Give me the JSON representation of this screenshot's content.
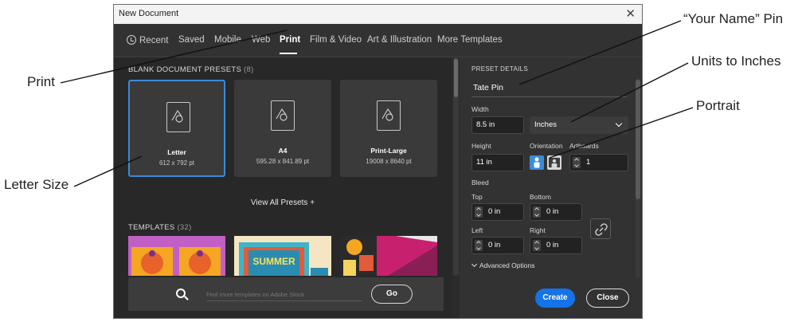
{
  "annotations": {
    "your_name_pin": "“Your Name” Pin",
    "units_to_inches": "Units to Inches",
    "portrait": "Portrait",
    "print": "Print",
    "letter_size": "Letter Size"
  },
  "window": {
    "title": "New Document",
    "close_glyph": "✕"
  },
  "tabs": [
    {
      "label": "Recent",
      "icon": "clock-icon"
    },
    {
      "label": "Saved"
    },
    {
      "label": "Mobile"
    },
    {
      "label": "Web"
    },
    {
      "label": "Print",
      "active": true
    },
    {
      "label": "Film & Video"
    },
    {
      "label": "Art & Illustration"
    },
    {
      "label": "More Templates"
    }
  ],
  "blank_presets": {
    "title": "BLANK DOCUMENT PRESETS",
    "count": "(8)",
    "items": [
      {
        "name": "Letter",
        "size": "612 x 792 pt",
        "selected": true
      },
      {
        "name": "A4",
        "size": "595.28 x 841.89 pt"
      },
      {
        "name": "Print-Large",
        "size": "19008 x 8640 pt"
      }
    ],
    "view_all": "View All Presets +"
  },
  "templates": {
    "title": "TEMPLATES",
    "count": "(32)",
    "thumb2_text": "SUMMER"
  },
  "search": {
    "placeholder": "Find more templates on Adobe Stock",
    "go_label": "Go"
  },
  "preset_details": {
    "title": "PRESET DETAILS",
    "name": "Tate Pin",
    "width_label": "Width",
    "width_value": "8.5 in",
    "units": "Inches",
    "height_label": "Height",
    "height_value": "11 in",
    "orientation_label": "Orientation",
    "artboards_label": "Artboards",
    "artboards_value": "1",
    "bleed_label": "Bleed",
    "top_label": "Top",
    "top_value": "0 in",
    "bottom_label": "Bottom",
    "bottom_value": "0 in",
    "left_label": "Left",
    "left_value": "0 in",
    "right_label": "Right",
    "right_value": "0 in",
    "advanced_label": "Advanced Options"
  },
  "buttons": {
    "create": "Create",
    "close": "Close"
  },
  "colors": {
    "accent": "#1473e6",
    "selection": "#3a8bd8",
    "panel": "#323232",
    "background": "#282828"
  }
}
